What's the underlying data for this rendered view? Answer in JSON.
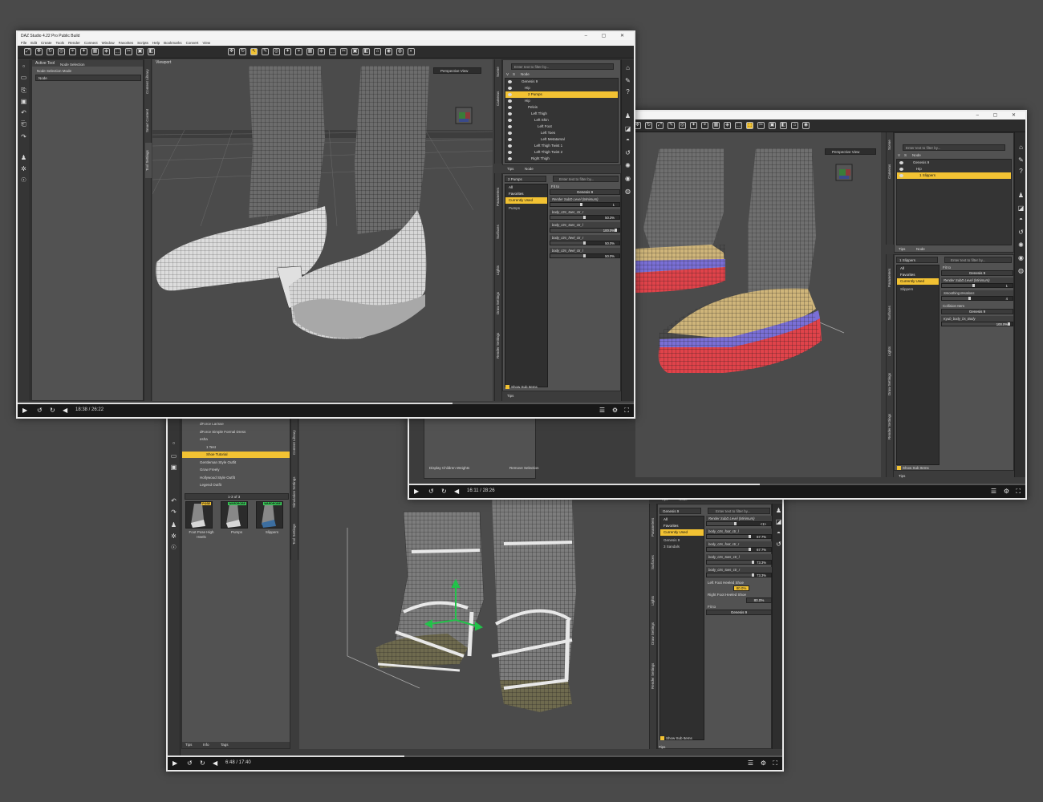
{
  "colors": {
    "selection": "#f2c233",
    "mesh_white": "#e8e8e8",
    "mesh_red": "#e0434a",
    "mesh_blue": "#7a6fd6",
    "mesh_tan": "#cfb57a",
    "background": "#4a4a4a"
  },
  "icons": [
    "play-icon",
    "rewind-icon",
    "replay-icon",
    "volume-icon",
    "chapters-icon",
    "gear-icon",
    "fullscreen-icon",
    "eye-icon",
    "search-icon",
    "home-icon",
    "help-icon"
  ],
  "win1": {
    "title": "DAZ Studio 4.22 Pro Public Build",
    "menu": [
      "File",
      "Edit",
      "Create",
      "Tools",
      "Render",
      "Connect",
      "Window",
      "Favorites",
      "Scripts",
      "Help",
      "Bookmarks",
      "Convert",
      "View"
    ],
    "tool_panel": {
      "title": "Active Tool",
      "subtitle": "Node Selection",
      "mode_label": "Node Selection Mode",
      "mode_value": "Node"
    },
    "left_tabs": [
      "Viewport",
      "Tool Settings",
      "Smart Content",
      "Content Library"
    ],
    "viewport_tab": "Viewport",
    "perspective": "Perspective View",
    "scene": {
      "filter_placeholder": "Enter text to filter by...",
      "header_v": "V",
      "header_s": "S",
      "header_node": "Node",
      "rows": [
        "Genesis 9",
        "Hip",
        "2 Pumps",
        "Hip",
        "Pelvis",
        "Left Thigh",
        "Left Shin",
        "Left Foot",
        "Left Toes",
        "Left Metatarsal",
        "Left Thigh Twist 1",
        "Left Thigh Twist 2",
        "Right Thigh"
      ],
      "tabs": [
        "Tips",
        "Node"
      ]
    },
    "side_tabs": [
      "Scene",
      "Cameras"
    ],
    "params": {
      "dropdown": "2 Pumps",
      "filter_placeholder": "Enter text to filter by...",
      "list": [
        "All",
        "Favorites",
        "Currently Used"
      ],
      "tree_item": "Pumps",
      "fit_label": "Fit to",
      "fit_value": "Genesis 9",
      "sliders": [
        {
          "label": "Render SubD Level (Minimum)",
          "value": "1",
          "frac": 0.45
        },
        {
          "label": "body_ctrs_toes_ctr_r",
          "value": "50.3%",
          "frac": 0.5
        },
        {
          "label": "body_ctrs_toes_ctr_l",
          "value": "100.0%",
          "frac": 0.95
        },
        {
          "label": "body_ctrs_heel_ctr_r",
          "value": "50.0%",
          "frac": 0.5
        },
        {
          "label": "body_ctrs_heel_ctr_l",
          "value": "50.0%",
          "frac": 0.5
        }
      ],
      "show_sub": "Show Sub Items",
      "tabs": [
        "Parameters",
        "Surfaces",
        "Lights",
        "Draw Settings",
        "Render Settings"
      ],
      "bottom_tab": "Tips"
    },
    "player": {
      "time": "18:38 / 26:22",
      "progress": 0.706
    }
  },
  "win2": {
    "perspective": "Perspective View",
    "scene": {
      "filter_placeholder": "Enter text to filter by...",
      "header_v": "V",
      "header_s": "S",
      "header_node": "Node",
      "rows": [
        "Genesis 9",
        "Hip",
        "1 Slippers"
      ],
      "tabs": [
        "Tips",
        "Node"
      ]
    },
    "side_tabs": [
      "Scene",
      "Cameras"
    ],
    "params": {
      "dropdown": "1 Slippers",
      "filter_placeholder": "Enter text to filter by...",
      "list": [
        "All",
        "Favorites",
        "Currently Used"
      ],
      "tree_item": "Slippers",
      "fit_label": "Fit to",
      "fit_value": "Genesis 9",
      "sliders": [
        {
          "label": "Render SubD Level (Minimum)",
          "value": "1",
          "frac": 0.45
        },
        {
          "label": "Smoothing Iterations",
          "value": "4",
          "frac": 0.4
        }
      ],
      "collision_label": "Collision Item",
      "collision_value": "Genesis 9",
      "last_slider": {
        "label": "Kyub_body_bs_Body",
        "value": "100.0%",
        "frac": 0.95
      },
      "show_sub": "Show Sub Items",
      "tabs": [
        "Parameters",
        "Surfaces",
        "Lights",
        "Draw Settings",
        "Render Settings"
      ],
      "bottom_tab": "Tips"
    },
    "behind_left": {
      "display_children": "Display Children Weights",
      "remove_sel": "Remove Selection"
    },
    "player": {
      "time": "16:11 / 28:26",
      "progress": 0.569
    }
  },
  "win3": {
    "content": {
      "folders": [
        "dForce Larisse",
        "dForce Simple Formal Dress",
        "esha",
        "1 Test",
        "Shoe Tutorial",
        "Gentleman Style Outfit",
        "Grow Freely",
        "Hollywood Style Outfit",
        "Legend Outfit"
      ],
      "pager": "1-3 of 3",
      "thumbs": [
        {
          "label": "Foot Pose High Heels",
          "badge": "POSE"
        },
        {
          "label": "Pumps",
          "badge": "WARDROBE"
        },
        {
          "label": "Slippers",
          "badge": "WARDROBE"
        }
      ],
      "tabs": [
        "Tips",
        "Info",
        "Tags"
      ]
    },
    "left_tabs": [
      "Content Library",
      "Simulation Settings",
      "Tool Settings"
    ],
    "scene_tabs": [
      "Tips",
      "Node"
    ],
    "params": {
      "dropdown": "Genesis 9",
      "filter_placeholder": "Enter text to filter by...",
      "list": [
        "All",
        "Favorites",
        "Currently Used"
      ],
      "tree_items": [
        "Genesis 9",
        "3 Sandals"
      ],
      "sliders": [
        {
          "label": "Render SubD Level (Minimum)",
          "value": "<1>",
          "frac": 0.45
        },
        {
          "label": "body_ctrs_foot_ctr_l",
          "value": "67.7%",
          "frac": 0.68
        },
        {
          "label": "body_ctrs_foot_ctr_r",
          "value": "67.7%",
          "frac": 0.68
        },
        {
          "label": "body_ctrs_toes_ctr_l",
          "value": "73.3%",
          "frac": 0.73
        },
        {
          "label": "body_ctrs_toes_ctr_r",
          "value": "73.3%",
          "frac": 0.73
        }
      ],
      "left_shoe": "Left Foot Heeled Shoe",
      "left_shoe_value": "80.0%",
      "right_shoe": "Right Foot Heeled Shoe",
      "right_shoe_value": "80.0%",
      "fit_label": "Fit to",
      "fit_value": "Genesis 9",
      "show_sub": "Show Sub Items",
      "tabs": [
        "Parameters",
        "Surfaces",
        "Lights",
        "Draw Settings",
        "Render Settings"
      ],
      "bottom_tab": "Tips"
    },
    "player": {
      "time": "6:48 / 17:40",
      "progress": 0.385
    }
  }
}
